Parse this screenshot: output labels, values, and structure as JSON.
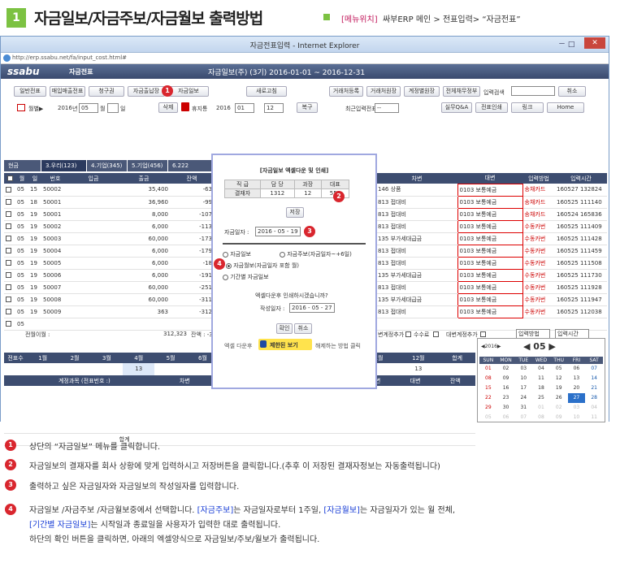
{
  "header": {
    "num": "1",
    "title": "자금일보/자금주보/자금월보 출력방법",
    "menu_label": "[메뉴위치]",
    "menu_path": "싸부ERP 메인 > 전표입력> “자금전표”"
  },
  "ie": {
    "title": "자금전표입력 - Internet Explorer",
    "url": "http://erp.ssabu.net/fa/input_cost.html#",
    "controls": "－ □",
    "close": "✕"
  },
  "app": {
    "logo": "ssabu",
    "section": "자금전표",
    "caption": "자금일보(주) (3기) 2016-01-01 ~ 2016-12-31"
  },
  "toolbar1": [
    "일반전표",
    "매입매출전표",
    "청구권",
    "자금출납장",
    "자금일보",
    "새로고침",
    "거래처등록",
    "거래처원장",
    "계정별원장",
    "전체채무정부"
  ],
  "toolbar1_input_label": "입력검색",
  "toolbar1_cancel": "취소",
  "toolbar2": {
    "kind": "월별▶",
    "year": "2016",
    "year_unit": "년",
    "month": "05",
    "month_unit": "월",
    "day_unit": "일",
    "delete": "삭제",
    "trash": "휴지통",
    "y2": "2016",
    "m2a": "01",
    "m2b": "12",
    "conf": "복구",
    "recent": "최근입력전표",
    "dash": "--",
    "qa": "실무Q&A",
    "print": "전표인쇄",
    "link": "링크",
    "home": "Home"
  },
  "tabs": [
    "현금",
    "3.우리(123)",
    "4.기업(345)",
    "5.기업(456)",
    "6.222"
  ],
  "grid_headers": [
    "",
    "월",
    "일",
    "번호",
    "입금",
    "출금",
    "잔액"
  ],
  "rows": [
    {
      "m": "05",
      "d": "15",
      "no": "50002",
      "in": "",
      "out": "35,400",
      "bal": "-63",
      "cd": "146",
      "acct": "상품",
      "opp": "0103 보통예금",
      "method": "송채카드",
      "time": "160527",
      "no2": "132824"
    },
    {
      "m": "05",
      "d": "18",
      "no": "50001",
      "in": "",
      "out": "36,960",
      "bal": "-99",
      "cd": "813",
      "acct": "접대비",
      "opp": "0103 보통예금",
      "method": "송채카드",
      "time": "160525",
      "no2": "111140"
    },
    {
      "m": "05",
      "d": "19",
      "no": "50001",
      "in": "",
      "out": "8,000",
      "bal": "-107",
      "cd": "813",
      "acct": "접대비",
      "opp": "0103 보통예금",
      "method": "송채카드",
      "time": "160524",
      "no2": "165836"
    },
    {
      "m": "05",
      "d": "19",
      "no": "50002",
      "in": "",
      "out": "6,000",
      "bal": "-113",
      "cd": "813",
      "acct": "접대비",
      "opp": "0103 보통예금",
      "method": "수동카번",
      "time": "160525",
      "no2": "111409"
    },
    {
      "m": "05",
      "d": "19",
      "no": "50003",
      "in": "",
      "out": "60,000",
      "bal": "-173",
      "cd": "135",
      "acct": "부가세대급금",
      "opp": "0103 보통예금",
      "method": "수동카번",
      "time": "160525",
      "no2": "111428"
    },
    {
      "m": "05",
      "d": "19",
      "no": "50004",
      "in": "",
      "out": "6,000",
      "bal": "-179",
      "cd": "813",
      "acct": "접대비",
      "opp": "0103 보통예금",
      "method": "수동카번",
      "time": "160525",
      "no2": "111459"
    },
    {
      "m": "05",
      "d": "19",
      "no": "50005",
      "in": "",
      "out": "6,000",
      "bal": "-18",
      "cd": "813",
      "acct": "접대비",
      "opp": "0103 보통예금",
      "method": "수동카번",
      "time": "160525",
      "no2": "111508"
    },
    {
      "m": "05",
      "d": "19",
      "no": "50006",
      "in": "",
      "out": "6,000",
      "bal": "-191",
      "cd": "135",
      "acct": "부가세대급금",
      "opp": "0103 보통예금",
      "method": "수동카번",
      "time": "160525",
      "no2": "111730"
    },
    {
      "m": "05",
      "d": "19",
      "no": "50007",
      "in": "",
      "out": "60,000",
      "bal": "-251",
      "cd": "813",
      "acct": "접대비",
      "opp": "0103 보통예금",
      "method": "수동카번",
      "time": "160525",
      "no2": "111928"
    },
    {
      "m": "05",
      "d": "19",
      "no": "50008",
      "in": "",
      "out": "60,000",
      "bal": "-311",
      "cd": "135",
      "acct": "부가세대급금",
      "opp": "0103 보통예금",
      "method": "수동카번",
      "time": "160525",
      "no2": "111947"
    },
    {
      "m": "05",
      "d": "19",
      "no": "50009",
      "in": "",
      "out": "363",
      "bal": "-312",
      "cd": "813",
      "acct": "접대비",
      "opp": "0103 보통예금",
      "method": "수동카번",
      "time": "160525",
      "no2": "112038"
    },
    {
      "m": "05",
      "d": "",
      "no": "",
      "in": "",
      "out": "",
      "bal": "",
      "cd": "",
      "acct": "",
      "opp": "",
      "method": "",
      "time": "",
      "no2": ""
    }
  ],
  "right_headers": [
    "차변",
    "대변",
    "입력방법",
    "입력시간"
  ],
  "footer": {
    "carry": "전월이월 :",
    "total_out": "312,323",
    "balance": "잔액 : -312",
    "chk1": "변계정추가",
    "chk2": "수수료",
    "chk3": "대변계정추가",
    "sel1": "입력방법",
    "sel2": "입력시간"
  },
  "monthly": {
    "label": "전표수",
    "months": [
      "1월",
      "2월",
      "3월",
      "4월",
      "5월",
      "6월",
      "7월",
      "8월",
      "9월",
      "10월",
      "11월",
      "12월",
      "합계"
    ],
    "vals": [
      "",
      "",
      "",
      "",
      "13",
      "",
      "",
      "",
      "",
      "",
      "",
      "",
      "13"
    ]
  },
  "bottom_headers": [
    "계정과목 (전표번호 :)",
    "차변",
    "대변",
    "건략",
    "전기이월",
    "차변",
    "대변",
    "잔액"
  ],
  "bottom_total": "합계",
  "calendar": {
    "year": "◀2016▶",
    "month": "◀ 05 ▶",
    "days": [
      "SUN",
      "MON",
      "TUE",
      "WED",
      "THU",
      "FRI",
      "SAT"
    ],
    "cells": [
      "01",
      "02",
      "03",
      "04",
      "05",
      "06",
      "07",
      "08",
      "09",
      "10",
      "11",
      "12",
      "13",
      "14",
      "15",
      "16",
      "17",
      "18",
      "19",
      "20",
      "21",
      "22",
      "23",
      "24",
      "25",
      "26",
      "27",
      "28",
      "29",
      "30",
      "31",
      "01",
      "02",
      "03",
      "04",
      "05",
      "06",
      "07",
      "08",
      "09",
      "10",
      "11"
    ]
  },
  "dialog": {
    "title": "[자금일보 엑셀다운 및 인쇄]",
    "heads": [
      "직 급",
      "담 당",
      "과장",
      "대표"
    ],
    "row_label": "결재자",
    "vals": [
      "1312",
      "12",
      "555"
    ],
    "save": "저장",
    "date_label": "자금일자 :",
    "date": "2016 - 05 - 19",
    "r1": "자금일보",
    "r2": "자금주보(자금일자~+6일)",
    "r3": "자금월보(자금일자 포함 월)",
    "r4": "기간별 자금일보",
    "q": "엑셀다운후 인쇄하시겠습니까?",
    "wdate_label": "작성일자 :",
    "wdate": "2016 - 05 - 27",
    "ok": "확인",
    "cancel": "취소",
    "note_a": "엑셀 다운후",
    "note_b": "제한된 보기",
    "note_c": "해제하는 방법 클릭"
  },
  "badges": [
    "1",
    "2",
    "3",
    "4"
  ],
  "instructions": [
    {
      "n": "1",
      "t": "상단의 “자금일보” 메뉴를 클릭합니다."
    },
    {
      "n": "2",
      "t": "자금일보의 결재자를 회사 상황에 맞게 입력하시고 저장버튼을 클릭합니다.(추후 이 저장된 결재자정보는 자동출력됩니다)"
    },
    {
      "n": "3",
      "t": "출력하고 싶은 자금일자와 자금일보의 작성일자를 입력합니다."
    },
    {
      "n": "4",
      "a": "자금일보 /자금주보 /자금월보중에서 선택합니다. ",
      "b": "[자금주보]",
      "c": "는 자금일자로부터 1주일, ",
      "d": "[자금월보]",
      "e": "는 자금일자가 있는 월 전체,",
      "f": "[기간별 자금일보]",
      "g": "는 시작일과 종료일을 사용자가 입력한 대로  출력됩니다.",
      "h": "하단의 확인 버튼을 클릭하면, 아래의 엑셀양식으로 자금일보/주보/월보가 출력됩니다."
    }
  ],
  "colors": {
    "accent": "#7cc242",
    "badge": "#d9262e",
    "link": "#1a3fd6",
    "nav": "#3d4d70"
  }
}
